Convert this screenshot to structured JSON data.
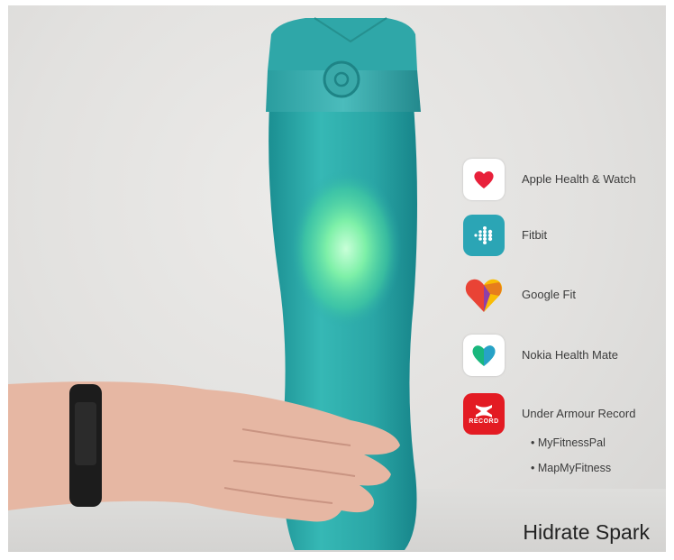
{
  "integrations": [
    {
      "label": "Apple Health & Watch",
      "icon": "heart-icon",
      "bg": "#ffffff",
      "accent": "#e8203a"
    },
    {
      "label": "Fitbit",
      "icon": "fitbit-dots-icon",
      "bg": "#2ba5b5",
      "accent": "#ffffff"
    },
    {
      "label": "Google Fit",
      "icon": "google-fit-heart-icon",
      "bg": "transparent",
      "accent": "#e94335"
    },
    {
      "label": "Nokia Health Mate",
      "icon": "green-heart-icon",
      "bg": "#ffffff",
      "accent": "#19b77d"
    },
    {
      "label": "Under Armour Record",
      "icon": "under-armour-logo-icon",
      "bg": "#e31b23",
      "accent": "#ffffff",
      "icon_text": "RECORD"
    }
  ],
  "sub_items": [
    "• MyFitnessPal",
    "• MapMyFitness"
  ],
  "caption": "Hidrate Spark",
  "colors": {
    "bottle": "#2aa8a8",
    "glow": "#7dffb0",
    "band": "#1c1c1c",
    "skin": "#e8b9a6"
  }
}
